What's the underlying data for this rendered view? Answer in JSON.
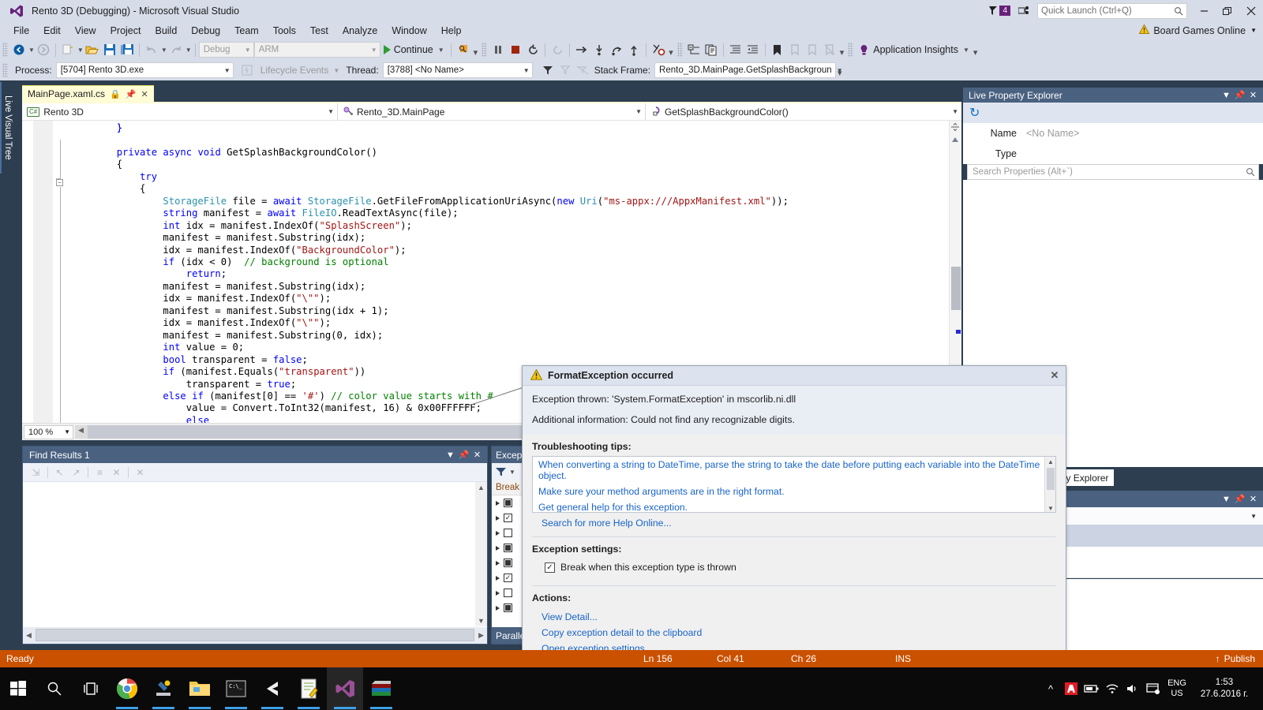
{
  "titlebar": {
    "title": "Rento 3D (Debugging) - Microsoft Visual Studio",
    "feedback_count": "4",
    "quick_launch_placeholder": "Quick Launch (Ctrl+Q)",
    "minimize": "–",
    "restore": "❐",
    "close": "✕"
  },
  "menubar": {
    "items": [
      "File",
      "Edit",
      "View",
      "Project",
      "Build",
      "Debug",
      "Team",
      "Tools",
      "Test",
      "Analyze",
      "Window",
      "Help"
    ],
    "account": "Board Games Online"
  },
  "toolbar": {
    "config_combo": "Debug",
    "platform_combo": "ARM",
    "continue_label": "Continue",
    "app_insights": "Application Insights"
  },
  "debugbar": {
    "process_label": "Process:",
    "process_value": "[5704] Rento 3D.exe",
    "lifecycle_label": "Lifecycle Events",
    "thread_label": "Thread:",
    "thread_value": "[3788] <No Name>",
    "stackframe_label": "Stack Frame:",
    "stackframe_value": "Rento_3D.MainPage.GetSplashBackgroun"
  },
  "left_dock": {
    "tab_label": "Live Visual Tree"
  },
  "editor": {
    "tab_title": "MainPage.xaml.cs",
    "tab_pin_icon": "pin-icon",
    "tab_close_icon": "close-icon",
    "nav_project": "Rento 3D",
    "nav_class": "Rento_3D.MainPage",
    "nav_member": "GetSplashBackgroundColor()",
    "cs_badge": "C#",
    "zoom_level": "100 %",
    "code_lines": [
      "        }",
      "",
      "        private async void GetSplashBackgroundColor()",
      "        {",
      "            try",
      "            {",
      "                StorageFile file = await StorageFile.GetFileFromApplicationUriAsync(new Uri(\"ms-appx:///AppxManifest.xml\"));",
      "                string manifest = await FileIO.ReadTextAsync(file);",
      "                int idx = manifest.IndexOf(\"SplashScreen\");",
      "                manifest = manifest.Substring(idx);",
      "                idx = manifest.IndexOf(\"BackgroundColor\");",
      "                if (idx < 0)  // background is optional",
      "                    return;",
      "                manifest = manifest.Substring(idx);",
      "                idx = manifest.IndexOf(\"\\\"\");",
      "                manifest = manifest.Substring(idx + 1);",
      "                idx = manifest.IndexOf(\"\\\"\");",
      "                manifest = manifest.Substring(0, idx);",
      "                int value = 0;",
      "                bool transparent = false;",
      "                if (manifest.Equals(\"transparent\"))",
      "                    transparent = true;",
      "                else if (manifest[0] == '#') // color value starts with #",
      "                    value = Convert.ToInt32(manifest, 16) & 0x00FFFFFF;",
      "                else"
    ]
  },
  "find_results": {
    "title": "Find Results 1",
    "collapse_icon": "chevron-down-icon",
    "pin_icon": "pin-icon",
    "close_icon": "close-icon"
  },
  "exception_settings_panel": {
    "title": "Except",
    "column_header": "Break ",
    "rows": [
      {
        "state": "filled"
      },
      {
        "state": "checked"
      },
      {
        "state": "empty"
      },
      {
        "state": "filled"
      },
      {
        "state": "filled"
      },
      {
        "state": "checked"
      },
      {
        "state": "empty"
      },
      {
        "state": "filled"
      }
    ],
    "bottom_tab": "Paralle"
  },
  "exception_popup": {
    "title": "FormatException occurred",
    "warning_icon": "warning-triangle-icon",
    "close_icon": "close-icon",
    "message_thrown": "Exception thrown: 'System.FormatException' in mscorlib.ni.dll",
    "message_additional": "Additional information: Could not find any recognizable digits.",
    "tips_heading": "Troubleshooting tips:",
    "tips": [
      "When converting a string to DateTime, parse the string to take the date before putting each variable into the DateTime object.",
      "Make sure your method arguments are in the right format.",
      "Get general help for this exception."
    ],
    "search_online": "Search for more Help Online...",
    "settings_heading": "Exception settings:",
    "settings_checkbox_label": "Break when this exception type is thrown",
    "settings_checkbox_checked": "✓",
    "actions_heading": "Actions:",
    "actions": [
      "View Detail...",
      "Copy exception detail to the clipboard",
      "Open exception settings"
    ]
  },
  "live_property_explorer": {
    "title": "Live Property Explorer",
    "refresh_icon": "refresh-icon",
    "collapse_icon": "chevron-down-icon",
    "pin_icon": "pin-icon",
    "close_icon": "close-icon",
    "name_label": "Name",
    "name_value": "<No Name>",
    "type_label": "Type",
    "type_value": "",
    "search_placeholder": "Search Properties (Alt+`)",
    "search_icon": "search-icon"
  },
  "right_dock_tabs": [
    {
      "label": "Explorer",
      "active": false
    },
    {
      "label": "Live Property Explorer",
      "active": true
    }
  ],
  "statusbar": {
    "ready": "Ready",
    "line": "Ln 156",
    "col": "Col 41",
    "ch": "Ch 26",
    "ins": "INS",
    "publish": "Publish",
    "publish_icon": "upload-arrow-icon"
  },
  "taskbar": {
    "items": [
      {
        "name": "start-button",
        "icon": "windows-logo-icon",
        "open": false
      },
      {
        "name": "search-button",
        "icon": "search-icon",
        "open": false
      },
      {
        "name": "task-view-button",
        "icon": "task-view-icon",
        "open": false
      },
      {
        "name": "chrome",
        "icon": "chrome-icon",
        "open": true
      },
      {
        "name": "app-blue",
        "icon": "tool-icon",
        "open": true
      },
      {
        "name": "file-explorer",
        "icon": "folder-icon",
        "open": true
      },
      {
        "name": "command-prompt",
        "icon": "console-icon",
        "open": true
      },
      {
        "name": "unity",
        "icon": "unity-icon",
        "open": true
      },
      {
        "name": "notepad",
        "icon": "notepad-icon",
        "open": true
      },
      {
        "name": "visual-studio",
        "icon": "vs-icon",
        "open": true
      },
      {
        "name": "winrar",
        "icon": "archive-icon",
        "open": true
      }
    ],
    "tray": {
      "chevron": "⌃",
      "icons": [
        "adobe-icon",
        "battery-icon",
        "wifi-icon",
        "volume-icon",
        "action-center-icon"
      ],
      "language_top": "ENG",
      "language_bottom": "US",
      "time": "1:53",
      "date": "27.6.2016 г."
    }
  }
}
